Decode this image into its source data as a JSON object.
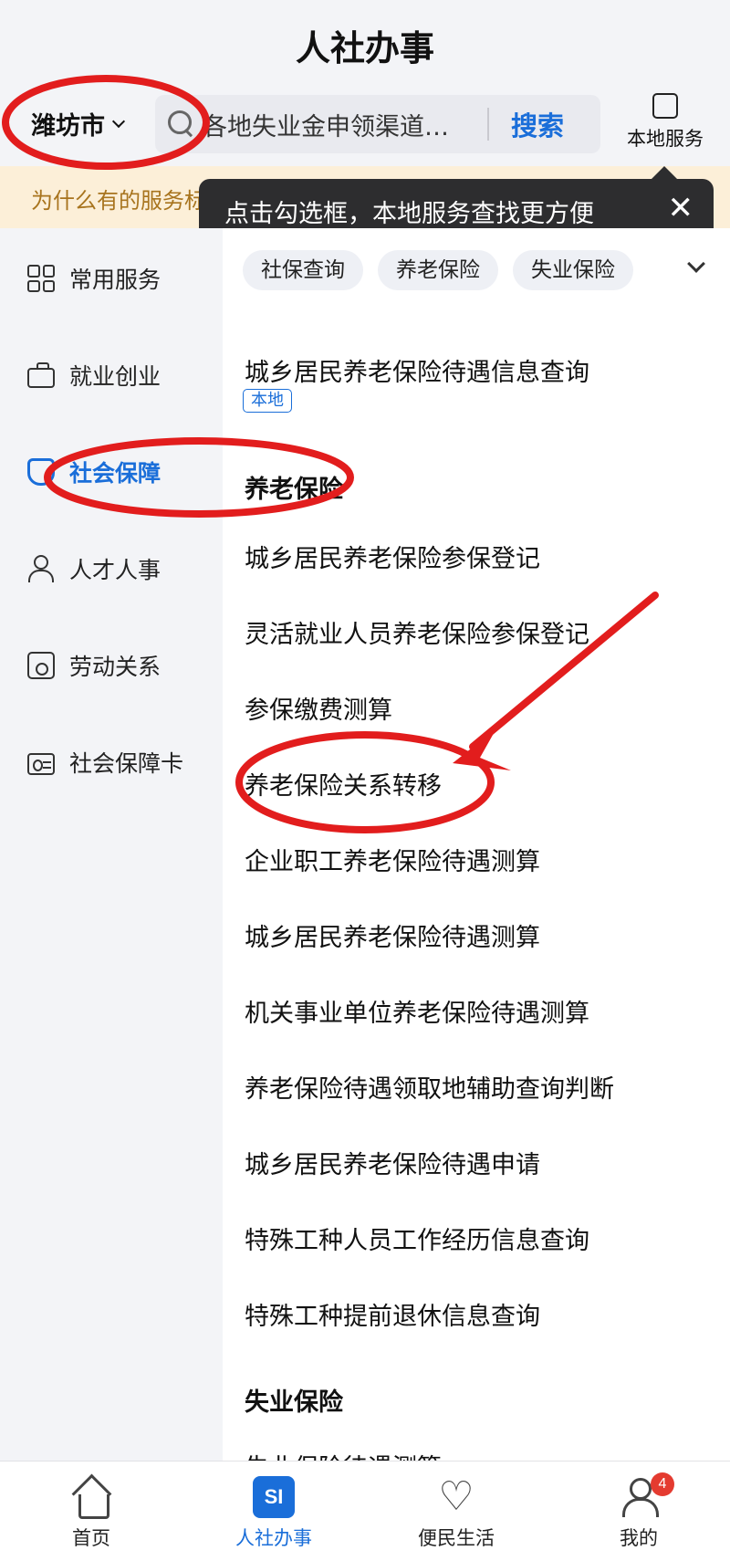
{
  "header": {
    "title": "人社办事",
    "city": "潍坊市",
    "search_placeholder": "各地失业金申领渠道…",
    "search_button": "搜索",
    "local_service_label": "本地服务"
  },
  "banner": {
    "text": "为什么有的服务标记了“本地”？ 查看详情",
    "close": "✕"
  },
  "tooltip": {
    "text": "点击勾选框，本地服务查找更方便",
    "close": "✕"
  },
  "sidebar": {
    "items": [
      {
        "label": "常用服务",
        "icon": "grid-icon"
      },
      {
        "label": "就业创业",
        "icon": "briefcase-icon"
      },
      {
        "label": "社会保障",
        "icon": "shield-icon",
        "active": true
      },
      {
        "label": "人才人事",
        "icon": "person-icon"
      },
      {
        "label": "劳动关系",
        "icon": "labor-icon"
      },
      {
        "label": "社会保障卡",
        "icon": "id-card-icon"
      }
    ]
  },
  "chips": [
    "社保查询",
    "养老保险",
    "失业保险"
  ],
  "main": {
    "top_service": {
      "label": "城乡居民养老保险待遇信息查询",
      "badge": "本地"
    },
    "section_pension": "养老保险",
    "pension_services": [
      "城乡居民养老保险参保登记",
      "灵活就业人员养老保险参保登记",
      "参保缴费测算",
      "养老保险关系转移",
      "企业职工养老保险待遇测算",
      "城乡居民养老保险待遇测算",
      "机关事业单位养老保险待遇测算",
      "养老保险待遇领取地辅助查询判断",
      "城乡居民养老保险待遇申请",
      "特殊工种人员工作经历信息查询",
      "特殊工种提前退休信息查询"
    ],
    "section_unemployment": "失业保险",
    "unemployment_services": [
      "失业保险待遇测算"
    ]
  },
  "tabbar": {
    "tabs": [
      {
        "label": "首页",
        "icon": "home-icon"
      },
      {
        "label": "人社办事",
        "icon": "si-icon",
        "active": true,
        "icon_text": "SI"
      },
      {
        "label": "便民生活",
        "icon": "heart-hand-icon"
      },
      {
        "label": "我的",
        "icon": "profile-icon",
        "badge": "4"
      }
    ]
  },
  "colors": {
    "accent": "#1a6ed9",
    "annotation_red": "#e21d1d",
    "banner_bg": "#fcefd8",
    "banner_text": "#a8741e",
    "tooltip_bg": "#2d2d2f"
  }
}
